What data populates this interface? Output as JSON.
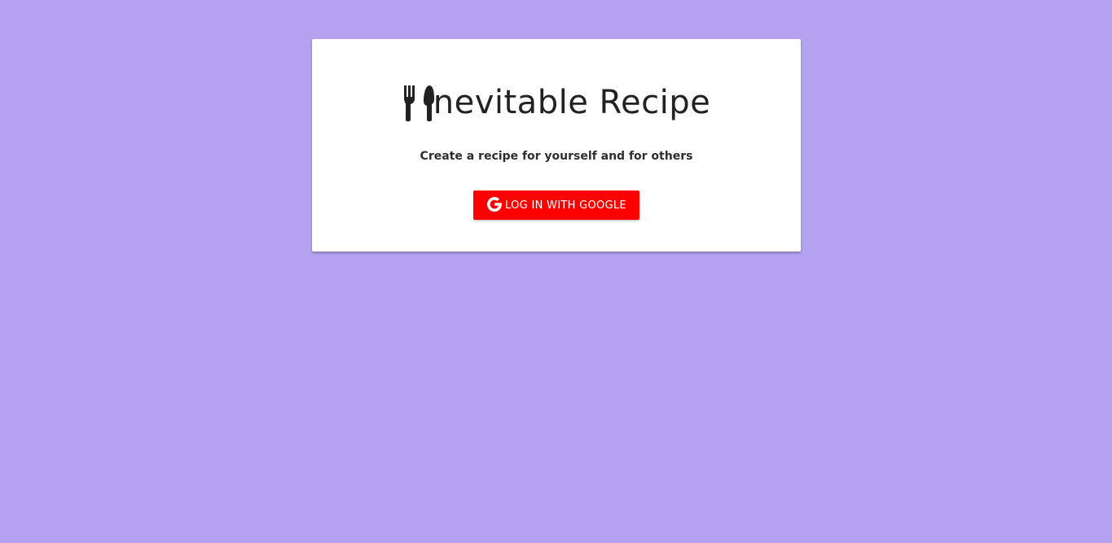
{
  "page": {
    "background_color": "#b3a2f0"
  },
  "card": {
    "title_icon": "fork-knife-icon",
    "title": "nevitable Recipe",
    "subtitle": "Create a recipe for yourself and for others",
    "login_button": {
      "icon": "google-icon",
      "label": "LOG IN WITH GOOGLE",
      "color": "#ff0000"
    }
  }
}
